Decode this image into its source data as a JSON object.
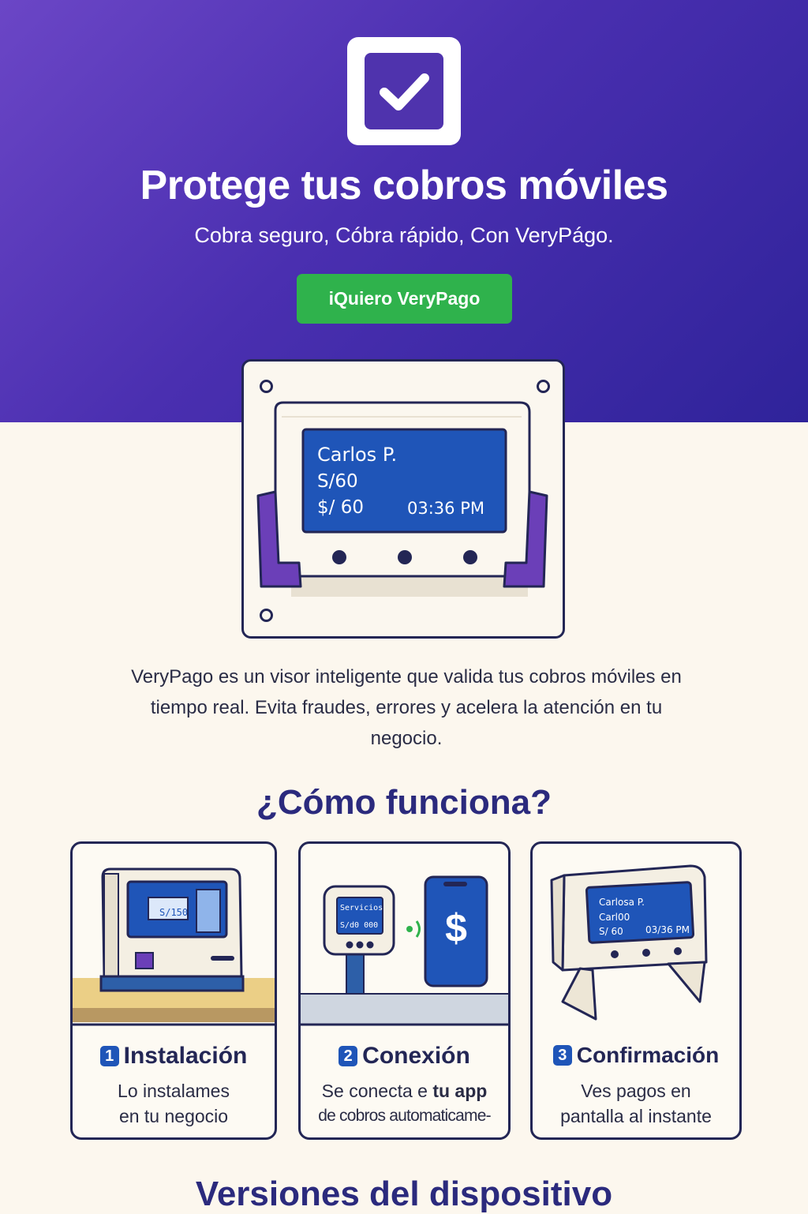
{
  "hero": {
    "title": "Protege tus cobros móviles",
    "subtitle": "Cobra seguro, Cóbra rápido, Con VeryPágo.",
    "cta_label": "iQuiero VeryPago"
  },
  "device": {
    "name": "Carlos P.",
    "amount_line1": "S/60",
    "amount_line2": "$/ 60",
    "time": "03:36 PM"
  },
  "description": "VeryPago es un visor inteligente que valida tus cobros móviles en tiempo real. Evita fraudes, errores y acelera la atención en tu negocio.",
  "how": {
    "title": "¿Cómo funciona?",
    "steps": [
      {
        "number": "1",
        "title": "Instalación",
        "line1": "Lo instalames",
        "line2": "en tu negocio",
        "screen_text": "S/150"
      },
      {
        "number": "2",
        "title": "Conexión",
        "line1_prefix": "Se conecta e ",
        "line1_bold": "tu app",
        "line2": "de cobros automaticame-",
        "screen_line1": "Servicios",
        "screen_line2": "S/d0 000",
        "phone_symbol": "$"
      },
      {
        "number": "3",
        "title": "Confirmación",
        "line1": "Ves pagos en",
        "line2": "pantalla al instante",
        "screen_name": "Carlosa P.",
        "screen_line2": "Carl00",
        "screen_amount": "S/ 60",
        "screen_time": "03/36 PM"
      }
    ]
  },
  "versions_title": "Versiones del dispositivo",
  "colors": {
    "hero_start": "#6b46c6",
    "hero_end": "#2f239a",
    "cta": "#2fb24c",
    "screen": "#1f55b8",
    "accent_purple": "#6b3fb8",
    "navy": "#232655",
    "background": "#fcf7ee"
  }
}
